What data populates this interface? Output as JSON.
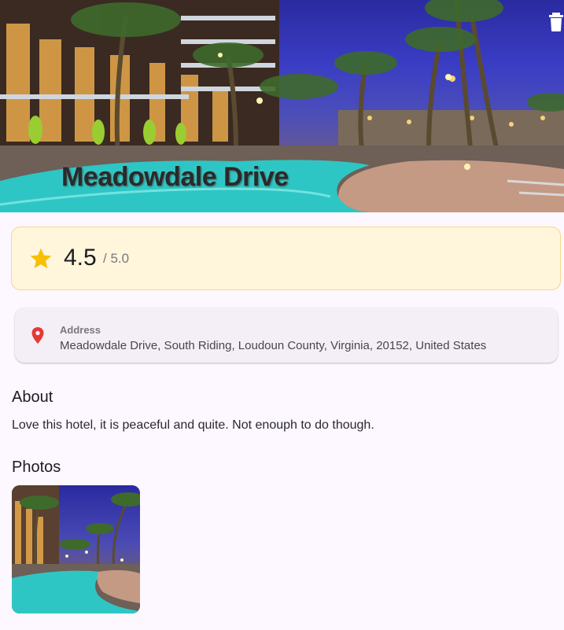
{
  "hotel": {
    "name": "Meadowdale Drive"
  },
  "rating": {
    "value": "4.5",
    "max": "/ 5.0",
    "star_color": "#f6c000"
  },
  "address": {
    "label": "Address",
    "value": "Meadowdale Drive, South Riding, Loudoun County, Virginia, 20152, United States",
    "pin_color": "#e53935"
  },
  "about": {
    "title": "About",
    "text": "Love this hotel, it is peaceful and quite. Not enouph to do though."
  },
  "photos": {
    "title": "Photos",
    "count": 1
  },
  "icons": {
    "delete": "trash-icon",
    "star": "star-icon",
    "location": "location-pin-icon"
  }
}
